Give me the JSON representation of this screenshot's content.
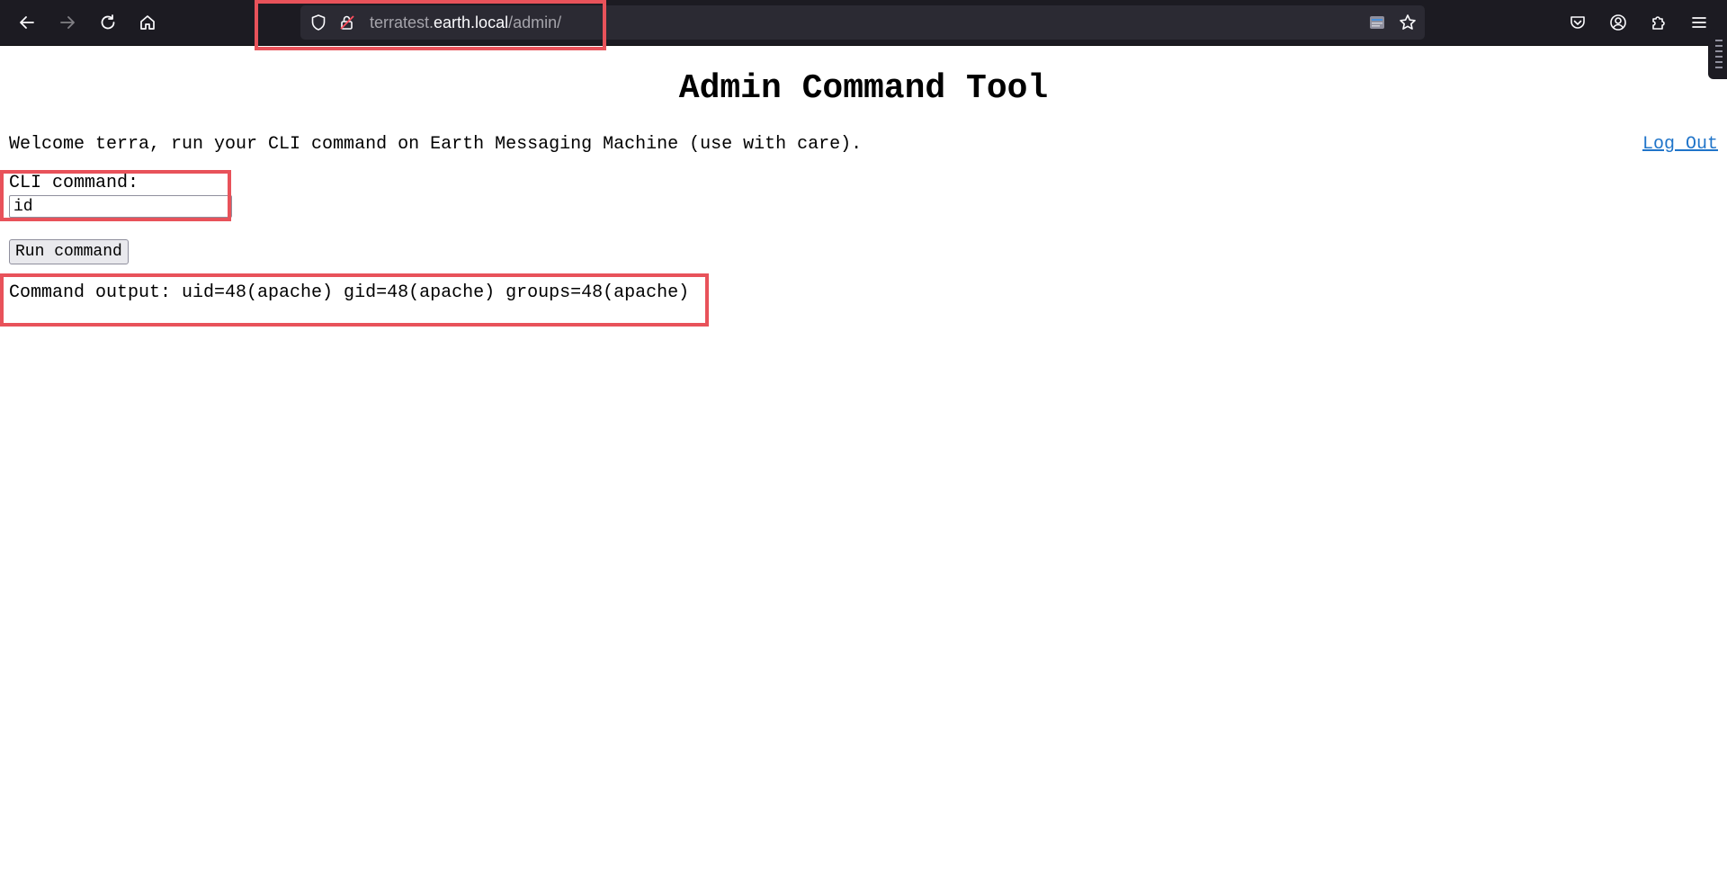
{
  "browser": {
    "url": {
      "prefix": "terratest.",
      "host": "earth.local",
      "path": "/admin/"
    },
    "icons": {
      "back": "arrow-left-icon",
      "forward": "arrow-right-icon",
      "reload": "reload-icon",
      "home": "home-icon",
      "tracking": "shield-icon",
      "lock": "lock-icon",
      "reader": "reader-view-icon",
      "bookmark": "star-icon",
      "pocket": "pocket-icon",
      "account": "account-icon",
      "extensions": "puzzle-icon",
      "menu": "hamburger-menu-icon"
    }
  },
  "page": {
    "title": "Admin Command Tool",
    "welcome": "Welcome terra, run your CLI command on Earth Messaging Machine (use with care).",
    "logout_label": "Log Out",
    "cli_label": "CLI command:",
    "cli_value": "id",
    "run_label": "Run command",
    "output_text": "Command output: uid=48(apache) gid=48(apache) groups=48(apache)"
  },
  "colors": {
    "annotation": "#e8525a",
    "link": "#1f74c9",
    "toolbar": "#1c1b22",
    "urlbar": "#2b2a33"
  }
}
